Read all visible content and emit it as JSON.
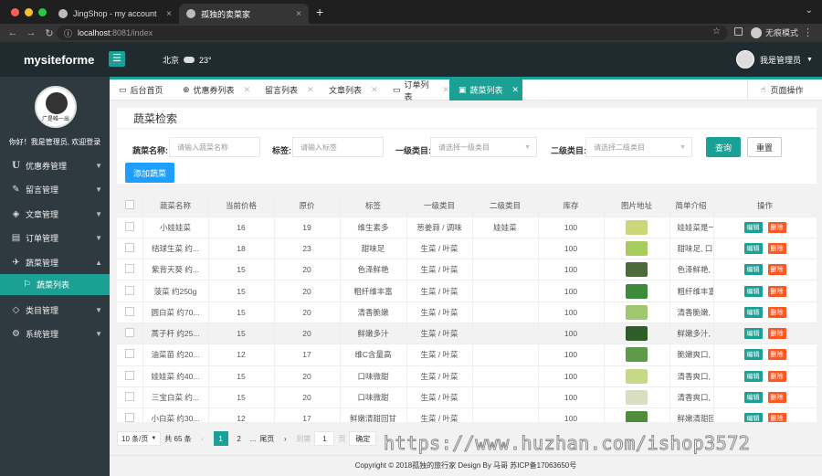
{
  "browser": {
    "dot_colors": [
      "#ff5f57",
      "#febc2e",
      "#28c840"
    ],
    "tabs": [
      {
        "title": "JingShop - my account"
      },
      {
        "title": "孤独的卖菜家"
      }
    ],
    "new_tab": "+",
    "url_host": "localhost",
    "url_path": ":8081/index",
    "incognito_label": "无痕模式"
  },
  "app": {
    "logo": "mysiteforme",
    "weather_city": "北京",
    "weather_temp": "23°",
    "user_label": "我是管理员",
    "accent": "#1aa094"
  },
  "sidebar": {
    "avatar_caption": "广是唯一出",
    "welcome": "你好！我是管理员, 欢迎登录",
    "items": [
      {
        "label": "优惠券管理",
        "icon": "U",
        "icon_name": "u-icon"
      },
      {
        "label": "留言管理",
        "icon": "✎",
        "icon_name": "edit-icon"
      },
      {
        "label": "文章管理",
        "icon": "◈",
        "icon_name": "cube-icon"
      },
      {
        "label": "订单管理",
        "icon": "▤",
        "icon_name": "list-icon"
      },
      {
        "label": "蔬菜管理",
        "icon": "✈",
        "icon_name": "send-icon"
      },
      {
        "label": "蔬菜列表",
        "icon": "⚐",
        "icon_name": "leaf-icon"
      },
      {
        "label": "类目管理",
        "icon": "◇",
        "icon_name": "diamond-icon"
      },
      {
        "label": "系统管理",
        "icon": "⚙",
        "icon_name": "gear-icon"
      }
    ]
  },
  "page_tabs": [
    {
      "label": "后台首页",
      "icon": "▭",
      "closable": false
    },
    {
      "label": "优惠券列表",
      "icon": "⊕",
      "closable": true
    },
    {
      "label": "留言列表",
      "icon": "",
      "closable": true
    },
    {
      "label": "文章列表",
      "icon": "",
      "closable": true
    },
    {
      "label": "订单列表",
      "icon": "▭",
      "closable": true
    },
    {
      "label": "蔬菜列表",
      "icon": "▣",
      "closable": true
    }
  ],
  "page_op_label": "页面操作",
  "search": {
    "title": "蔬菜检索",
    "name_label": "蔬菜名称:",
    "name_placeholder": "请输入蔬菜名称",
    "tag_label": "标签:",
    "tag_placeholder": "请输入标签",
    "cat1_label": "一级类目:",
    "cat1_placeholder": "请选择一级类目",
    "cat2_label": "二级类目:",
    "cat2_placeholder": "请选择二级类目",
    "query_btn": "查询",
    "reset_btn": "重置",
    "add_btn": "添加蔬菜"
  },
  "table": {
    "headers": [
      "蔬菜名称",
      "当前价格",
      "原价",
      "标签",
      "一级类目",
      "二级类目",
      "库存",
      "图片地址",
      "简单介绍",
      "操作"
    ],
    "edit_label": "编辑",
    "delete_label": "删除",
    "rows": [
      {
        "name": "小娃娃菜",
        "price": "16",
        "orig": "19",
        "tag": "维生素多",
        "cat1": "葱姜蒜 / 调味",
        "cat2": "娃娃菜",
        "stock": "100",
        "img_color": "#c9d67a",
        "desc": "娃娃菜是一"
      },
      {
        "name": "结球生菜 约...",
        "price": "18",
        "orig": "23",
        "tag": "甜味足",
        "cat1": "生菜 / 叶菜",
        "cat2": "",
        "stock": "100",
        "img_color": "#a6cc5e",
        "desc": "甜味足, 口"
      },
      {
        "name": "紫背天葵 约...",
        "price": "15",
        "orig": "20",
        "tag": "色泽鲜艳",
        "cat1": "生菜 / 叶菜",
        "cat2": "",
        "stock": "100",
        "img_color": "#4d6b3a",
        "desc": "色泽鲜艳,"
      },
      {
        "name": "菠菜 约250g",
        "price": "15",
        "orig": "20",
        "tag": "粗纤维丰富",
        "cat1": "生菜 / 叶菜",
        "cat2": "",
        "stock": "100",
        "img_color": "#3d8a3a",
        "desc": "粗纤维丰富"
      },
      {
        "name": "圆白菜 约70...",
        "price": "15",
        "orig": "20",
        "tag": "清香脆嫩",
        "cat1": "生菜 / 叶菜",
        "cat2": "",
        "stock": "100",
        "img_color": "#9ec76e",
        "desc": "清香脆嫩,"
      },
      {
        "name": "蒿子杆 约25...",
        "price": "15",
        "orig": "20",
        "tag": "鲜嫩多汁",
        "cat1": "生菜 / 叶菜",
        "cat2": "",
        "stock": "100",
        "img_color": "#2f5d2a",
        "desc": "鲜嫩多汁,"
      },
      {
        "name": "油菜苗 约20...",
        "price": "12",
        "orig": "17",
        "tag": "维C含量高",
        "cat1": "生菜 / 叶菜",
        "cat2": "",
        "stock": "100",
        "img_color": "#5f9a48",
        "desc": "脆嫩爽口,"
      },
      {
        "name": "娃娃菜 约40...",
        "price": "15",
        "orig": "20",
        "tag": "口味微甜",
        "cat1": "生菜 / 叶菜",
        "cat2": "",
        "stock": "100",
        "img_color": "#c6d98a",
        "desc": "清香爽口,"
      },
      {
        "name": "三宝白菜 约...",
        "price": "15",
        "orig": "20",
        "tag": "口味微甜",
        "cat1": "生菜 / 叶菜",
        "cat2": "",
        "stock": "100",
        "img_color": "#d8dfc0",
        "desc": "清香爽口,"
      },
      {
        "name": "小白菜 约30...",
        "price": "12",
        "orig": "17",
        "tag": "鲜嫩清甜回甘",
        "cat1": "生菜 / 叶菜",
        "cat2": "",
        "stock": "100",
        "img_color": "#4f8c3c",
        "desc": "鲜嫩清甜回"
      }
    ]
  },
  "pager": {
    "per_page": "10 条/页",
    "total": "共 65 条",
    "prev": "‹",
    "current": "1",
    "next_page": "2",
    "ellipsis": "...",
    "last": "尾页",
    "next": "›",
    "goto": "到第",
    "goto_value": "1",
    "page_unit": "页",
    "confirm": "确定"
  },
  "footer": "Copyright © 2018孤独的旅行家 Design By 马哥 苏ICP备17063650号",
  "watermark": "https://www.huzhan.com/ishop3572"
}
